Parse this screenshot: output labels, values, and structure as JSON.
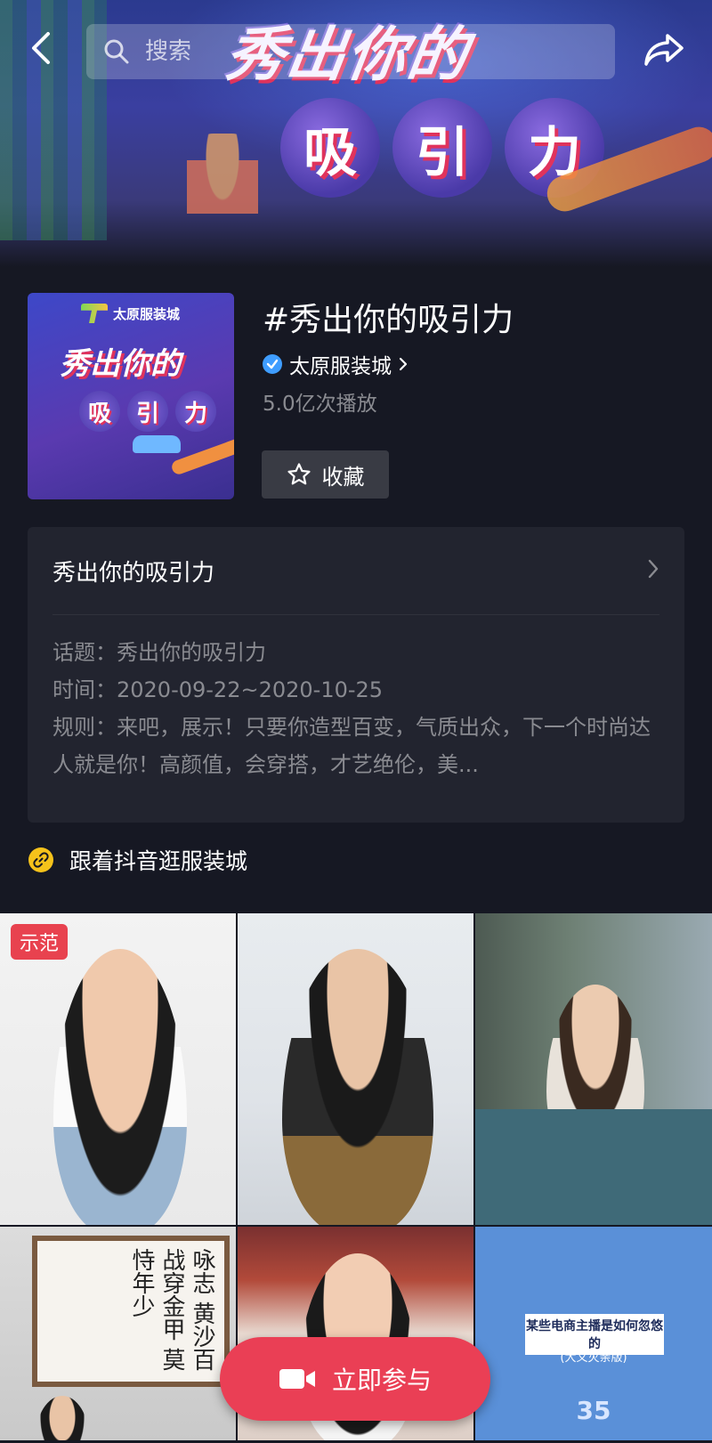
{
  "banner": {
    "art_title": "秀出你的",
    "art_chars": [
      "吸",
      "引",
      "力"
    ]
  },
  "search": {
    "placeholder": "搜索"
  },
  "topic": {
    "cover_brand": "太原服装城",
    "cover_title": "秀出你的",
    "cover_chars": [
      "吸",
      "引",
      "力"
    ],
    "title": "#秀出你的吸引力",
    "creator": "太原服装城",
    "plays": "5.0亿次播放",
    "favorite_label": "收藏"
  },
  "card": {
    "title": "秀出你的吸引力",
    "topic_line": "话题：秀出你的吸引力",
    "time_line": "时间：2020-09-22~2020-10-25",
    "rules_line": "规则：来吧，展示！只要你造型百变，气质出众，下一个时尚达人就是你！高颜值，会穿搭，才艺绝伦，美..."
  },
  "shop_link": {
    "label": "跟着抖音逛服装城"
  },
  "grid": {
    "demo_badge": "示范",
    "calligraphy": "咏志 黄沙百战穿金甲 莫恃年少",
    "video6_headline": "某些电商主播是如何忽悠的",
    "video6_sub": "(大义灭亲版)",
    "video6_num": "35"
  },
  "join": {
    "label": "立即参与"
  },
  "colors": {
    "background": "#161823",
    "accent": "#ea3f55",
    "verified": "#3f9dff",
    "link_icon": "#f5c21b"
  },
  "icons": [
    "back-arrow-icon",
    "search-icon",
    "share-icon",
    "verified-icon",
    "chevron-right-icon",
    "star-icon",
    "link-icon",
    "camera-icon"
  ]
}
